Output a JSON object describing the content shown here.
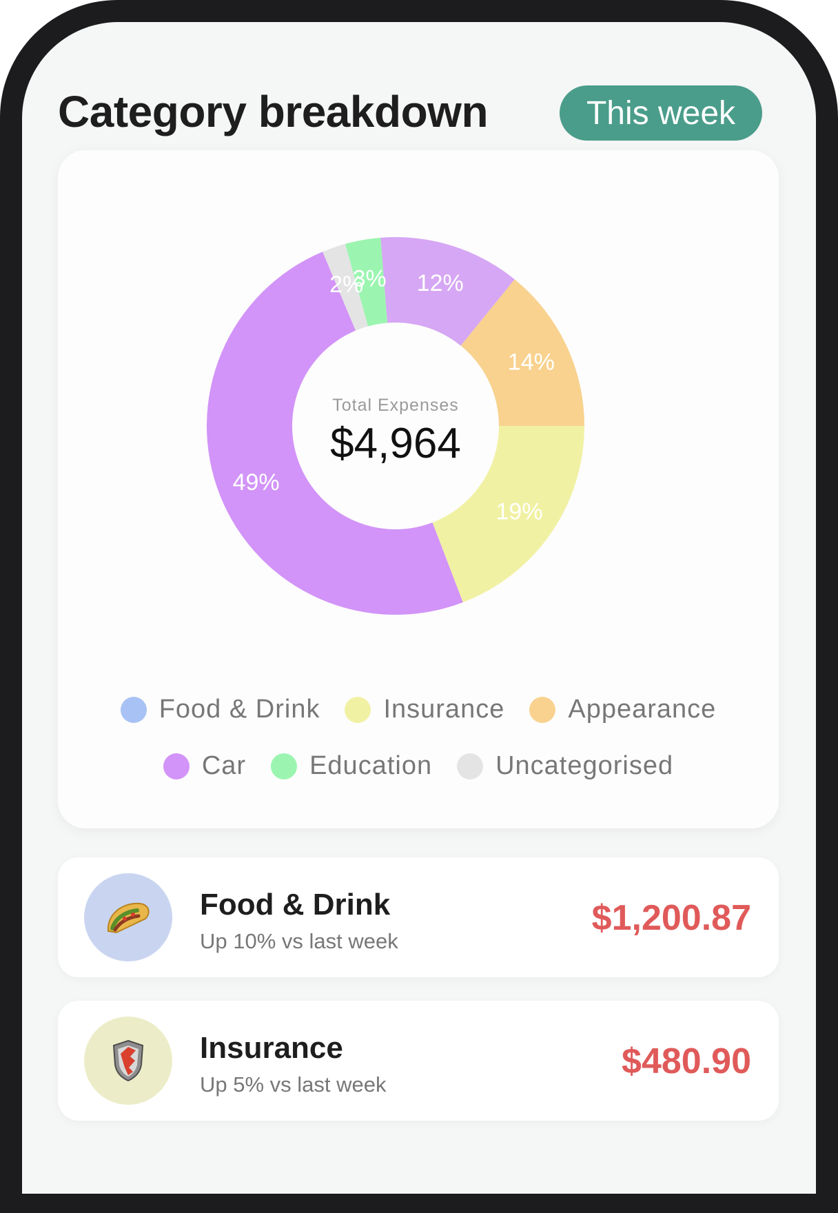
{
  "header": {
    "title": "Category breakdown",
    "period_button": "This week"
  },
  "chart": {
    "center_label": "Total Expenses",
    "center_value": "$4,964"
  },
  "chart_data": {
    "type": "pie",
    "categories": [
      "Food & Drink",
      "Insurance",
      "Appearance",
      "Car",
      "Education",
      "Uncategorised"
    ],
    "slices": [
      {
        "name": "Insurance",
        "value": 19,
        "label": "19%",
        "color": "#f1f1a4"
      },
      {
        "name": "Car",
        "value": 49,
        "label": "49%",
        "color": "#d294f8"
      },
      {
        "name": "Uncategorised",
        "value": 2,
        "label": "2%",
        "color": "#e4e4e4"
      },
      {
        "name": "Education",
        "value": 3,
        "label": "3%",
        "color": "#9bf5b0"
      },
      {
        "name": "Car",
        "value": 12,
        "label": "12%",
        "color": "#d6a7f4"
      },
      {
        "name": "Appearance",
        "value": 14,
        "label": "14%",
        "color": "#f8d28e"
      }
    ]
  },
  "legend": [
    {
      "label": "Food & Drink",
      "color": "#a8c2f5"
    },
    {
      "label": "Insurance",
      "color": "#f1f1a4"
    },
    {
      "label": "Appearance",
      "color": "#f8d28e"
    },
    {
      "label": "Car",
      "color": "#d294f8"
    },
    {
      "label": "Education",
      "color": "#9bf5b0"
    },
    {
      "label": "Uncategorised",
      "color": "#e4e4e4"
    }
  ],
  "categories": [
    {
      "name": "Food & Drink",
      "subtitle": "Up 10% vs last week",
      "amount": "$1,200.87",
      "icon": "taco-icon",
      "icon_bg": "#c9d5f0"
    },
    {
      "name": "Insurance",
      "subtitle": "Up 5% vs last week",
      "amount": "$480.90",
      "icon": "shield-icon",
      "icon_bg": "#ecedc8"
    }
  ]
}
